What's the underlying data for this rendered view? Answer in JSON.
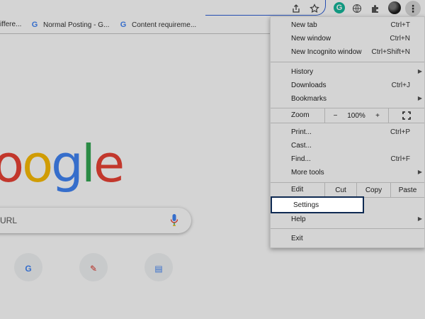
{
  "toolbar": {
    "icons": [
      "share-icon",
      "star-icon",
      "grammarly-icon",
      "globe-icon",
      "extensions-icon",
      "avatar",
      "more-icon"
    ],
    "grammarly_letter": "G",
    "more_glyph": "⋮"
  },
  "bookmarks": [
    {
      "label": "iffere..."
    },
    {
      "label": "Normal Posting - G...",
      "icon": "G"
    },
    {
      "label": "Content requireme...",
      "icon": "G"
    }
  ],
  "page": {
    "logo_letters": [
      "o",
      "o",
      "g",
      "l",
      "e"
    ],
    "logo_colors": [
      "#ea4335",
      "#fbbc05",
      "#4285f4",
      "#34a853",
      "#ea4335"
    ],
    "search_placeholder": "URL",
    "shortcut_icons": [
      {
        "glyph": "G",
        "color": "#4285f4"
      },
      {
        "glyph": "✎",
        "color": "#d93025"
      },
      {
        "glyph": "▤",
        "color": "#4285f4"
      }
    ]
  },
  "menu": {
    "new_tab": {
      "label": "New tab",
      "shortcut": "Ctrl+T"
    },
    "new_window": {
      "label": "New window",
      "shortcut": "Ctrl+N"
    },
    "new_incognito": {
      "label": "New Incognito window",
      "shortcut": "Ctrl+Shift+N"
    },
    "history": {
      "label": "History"
    },
    "downloads": {
      "label": "Downloads",
      "shortcut": "Ctrl+J"
    },
    "bookmarks": {
      "label": "Bookmarks"
    },
    "zoom": {
      "label": "Zoom",
      "minus": "−",
      "value": "100%",
      "plus": "+"
    },
    "print": {
      "label": "Print...",
      "shortcut": "Ctrl+P"
    },
    "cast": {
      "label": "Cast..."
    },
    "find": {
      "label": "Find...",
      "shortcut": "Ctrl+F"
    },
    "more_tools": {
      "label": "More tools"
    },
    "edit": {
      "label": "Edit",
      "cut": "Cut",
      "copy": "Copy",
      "paste": "Paste"
    },
    "settings": {
      "label": "Settings"
    },
    "help": {
      "label": "Help"
    },
    "exit": {
      "label": "Exit"
    },
    "arrow_glyph": "▶"
  }
}
